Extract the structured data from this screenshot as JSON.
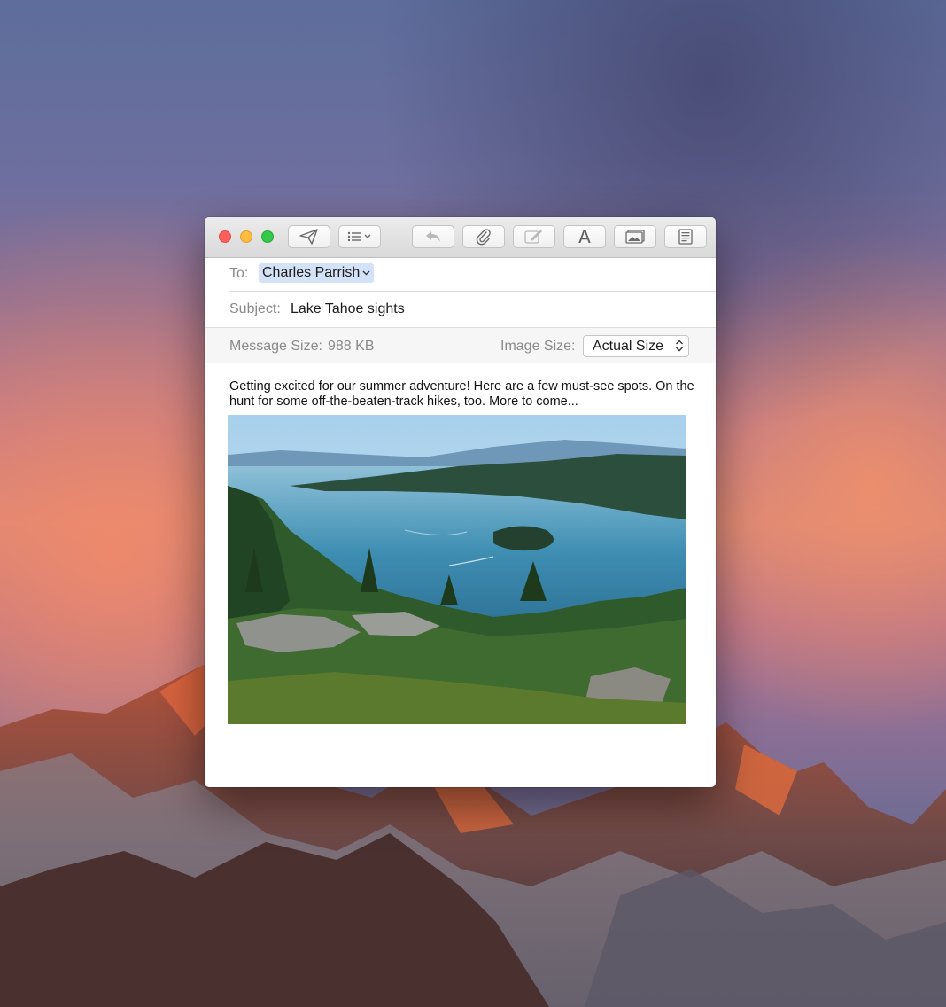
{
  "window": {
    "toolbar": {
      "send_icon": "paper-plane-icon",
      "header_fields_icon": "list-with-chevron-icon",
      "reply_icon": "reply-arrow-icon",
      "attach_icon": "paperclip-icon",
      "markup_icon": "markup-icon",
      "format_icon": "font-letter-a-icon",
      "photo_browser_icon": "photo-browser-icon",
      "stationery_icon": "stationery-icon",
      "format_glyph": "A"
    },
    "traffic_lights": {
      "close": "#fc605c",
      "minimize": "#fdbc40",
      "zoom": "#34c84a"
    }
  },
  "compose": {
    "to_label": "To:",
    "to_recipient": "Charles Parrish",
    "to_chevron": "⌄",
    "subject_label": "Subject:",
    "subject_value": "Lake Tahoe sights",
    "message_size_label": "Message Size:",
    "message_size_value": "988 KB",
    "image_size_label": "Image Size:",
    "image_size_value": "Actual Size",
    "body_text": "Getting excited for our summer adventure! Here are a few must-see spots. On the hunt for some off-the-beaten-track hikes, too. More to come..."
  },
  "colors": {
    "recipient_highlight": "#d3e2f7",
    "window_bg": "#ffffff",
    "titlebar_bg": "#e3e3e3"
  }
}
